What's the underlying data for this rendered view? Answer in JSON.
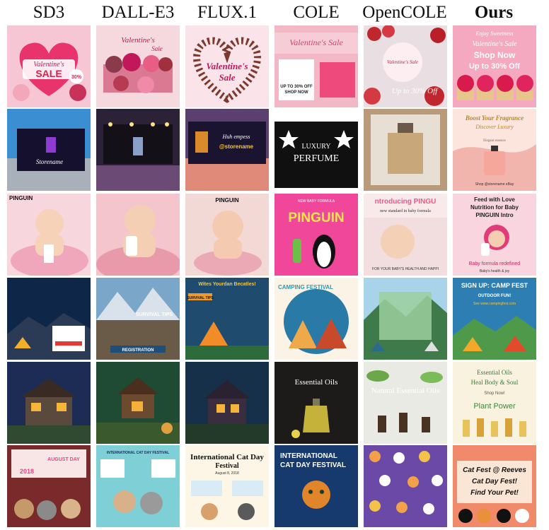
{
  "columns": [
    "SD3",
    "DALL-E3",
    "FLUX.1",
    "COLE",
    "OpenCOLE",
    "Ours"
  ],
  "tiles": {
    "r0": {
      "sd3": {
        "l1": "Valentine's",
        "l2": "SALE",
        "b1": "30%"
      },
      "dalle": {
        "l1": "Valentine's",
        "l2": "Sale"
      },
      "flux": {
        "l1": "Valentine's",
        "l2": "Sale"
      },
      "cole": {
        "l1": "Valentine's Sale",
        "l2": "UP TO 30% OFF",
        "l3": "SHOP NOW"
      },
      "open": {
        "l1": "Valentine's Sale",
        "l2": "Up to 30% Off"
      },
      "ours": {
        "l1": "Enjoy Sweetness",
        "l2": "Valentine's Sale",
        "l3": "Shop Now",
        "l4": "Up to 30% Off"
      }
    },
    "r1": {
      "sd3": {
        "l1": "Storename"
      },
      "dalle": {},
      "flux": {
        "l1": "Huh empess",
        "l2": "@storename"
      },
      "cole": {
        "l1": "LUXURY",
        "l2": "PERFUME"
      },
      "open": {},
      "ours": {
        "l1": "Boost Your Fragrance",
        "l2": "Discover Luxury",
        "l3": "Elegant essence",
        "l4": "Shop @storename eBay"
      }
    },
    "r2": {
      "sd3": {
        "l1": "PINGUIN"
      },
      "dalle": {},
      "flux": {
        "l1": "PINGUIN"
      },
      "cole": {
        "l1": "NEW BABY FORMULA",
        "l2": "PINGUIN"
      },
      "open": {
        "l1": "ntroducing PINGU",
        "l2": "new standard in baby formula",
        "l3": "FOR YOUR BABY'S HEALTH AND HAPPI"
      },
      "ours": {
        "l1": "Feed with Love",
        "l2": "Nutrition for Baby",
        "l3": "PINGUIN Intro",
        "l4": "Baby formula redefined",
        "l5": "Baby's health & joy"
      }
    },
    "r3": {
      "sd3": {},
      "dalle": {
        "l1": "SURVIVAL TIPS",
        "l2": "REGISTRATION"
      },
      "flux": {
        "l1": "Wites Yourdan Becatles!",
        "l2": "SURVIVAL TIPS"
      },
      "cole": {
        "l1": "CAMPING FESTIVAL"
      },
      "open": {},
      "ours": {
        "l1": "SIGN UP: CAMP FEST",
        "l2": "OUTDOOR FUN!",
        "l3": "See www.campingfest.com"
      }
    },
    "r4": {
      "sd3": {},
      "dalle": {},
      "flux": {},
      "cole": {
        "l1": "Essential Oils"
      },
      "open": {
        "l1": "Natural Essential Oils"
      },
      "ours": {
        "l1": "Essential Oils",
        "l2": "Heal Body & Soul",
        "l3": "Shop Now!",
        "l4": "Plant Power"
      }
    },
    "r5": {
      "sd3": {
        "l1": "AUGUST DAY",
        "l2": "2018"
      },
      "dalle": {
        "l1": "INTERNATIONAL CAT DAY FESTIVAL"
      },
      "flux": {
        "l1": "International Cat Day",
        "l2": "Festival",
        "l3": "August 8, 2018"
      },
      "cole": {
        "l1": "INTERNATIONAL",
        "l2": "CAT DAY FESTIVAL"
      },
      "open": {},
      "ours": {
        "l1": "Cat Fest @ Reeves",
        "l2": "Cat Day Fest!",
        "l3": "Find Your Pet!"
      }
    }
  }
}
